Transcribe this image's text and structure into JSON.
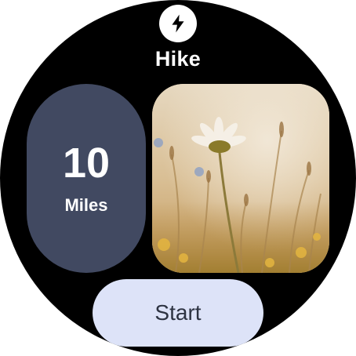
{
  "app": {
    "icon": "lightning-bolt-icon",
    "title": "Hike"
  },
  "stat": {
    "value": "10",
    "unit": "Miles"
  },
  "photo": {
    "subject": "daisy-in-grass-image"
  },
  "actions": {
    "start_label": "Start"
  },
  "colors": {
    "background": "#000000",
    "stat_card": "#414961",
    "start_button": "#dde3f8",
    "start_text": "#2d3342"
  }
}
